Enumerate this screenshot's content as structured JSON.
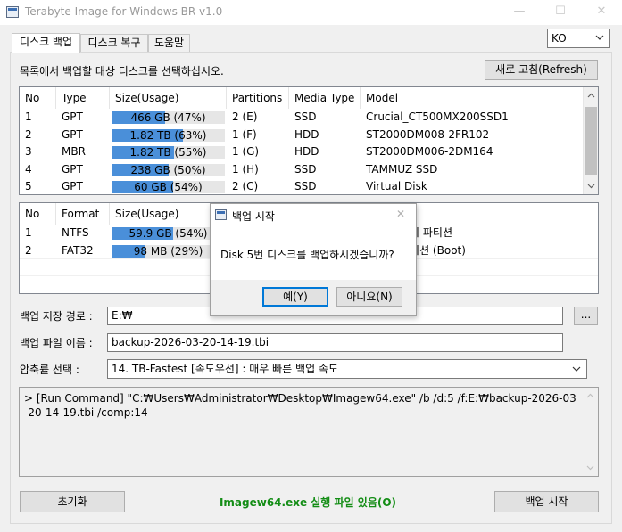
{
  "window": {
    "title": "Terabyte Image for Windows BR v1.0",
    "minimize": "—",
    "maximize": "☐",
    "close": "✕"
  },
  "tabs": [
    {
      "label": "디스크 백업",
      "active": true
    },
    {
      "label": "디스크 복구",
      "active": false
    },
    {
      "label": "도움말",
      "active": false
    }
  ],
  "language": {
    "selected": "KO"
  },
  "instruction": "목록에서 백업할 대상 디스크를 선택하십시오.",
  "refresh_label": "새로 고침(Refresh)",
  "disks": {
    "columns": [
      "No",
      "Type",
      "Size(Usage)",
      "Partitions",
      "Media Type",
      "Model"
    ],
    "rows": [
      {
        "no": "1",
        "type": "GPT",
        "size": "466 GB (47%)",
        "usage": 0.47,
        "partitions": "2 (E)",
        "media": "SSD",
        "model": "Crucial_CT500MX200SSD1"
      },
      {
        "no": "2",
        "type": "GPT",
        "size": "1.82 TB (63%)",
        "usage": 0.63,
        "partitions": "1 (F)",
        "media": "HDD",
        "model": "ST2000DM008-2FR102"
      },
      {
        "no": "3",
        "type": "MBR",
        "size": "1.82 TB (55%)",
        "usage": 0.55,
        "partitions": "1 (G)",
        "media": "HDD",
        "model": "ST2000DM006-2DM164"
      },
      {
        "no": "4",
        "type": "GPT",
        "size": "238 GB (50%)",
        "usage": 0.5,
        "partitions": "1 (H)",
        "media": "SSD",
        "model": "TAMMUZ SSD"
      },
      {
        "no": "5",
        "type": "GPT",
        "size": "60 GB (54%)",
        "usage": 0.54,
        "partitions": "2 (C)",
        "media": "SSD",
        "model": "Virtual Disk"
      }
    ]
  },
  "partitions": {
    "columns": [
      "No",
      "Format",
      "Size(Usage)"
    ],
    "rows": [
      {
        "no": "1",
        "format": "NTFS",
        "size": "59.9 GB (54%)",
        "usage": 0.54,
        "label": "설치 파티션"
      },
      {
        "no": "2",
        "format": "FAT32",
        "size": "98 MB (29%)",
        "usage": 0.29,
        "label": "파티션 (Boot)"
      }
    ]
  },
  "backup_path": {
    "label": "백업 저장 경로 :",
    "value": "E:₩",
    "browse": "..."
  },
  "backup_file": {
    "label": "백업 파일 이름 :",
    "value": "backup-2026-03-20-14-19.tbi"
  },
  "compression": {
    "label": "압축률 선택 :",
    "value": "14. TB-Fastest [속도우선] : 매우 빠른 백업 속도"
  },
  "log": "> [Run Command] \"C:₩Users₩Administrator₩Desktop₩Imagew64.exe\" /b /d:5 /f:E:₩backup-2026-03-20-14-19.tbi /comp:14",
  "reset_label": "초기화",
  "status": "Imagew64.exe 실행 파일 있음(O)",
  "start_label": "백업 시작",
  "dialog": {
    "title": "백업 시작",
    "message": "Disk 5번 디스크를 백업하시겠습니까?",
    "yes": "예(Y)",
    "no": "아니요(N)",
    "close": "✕"
  },
  "colors": {
    "usage_bar": "#4a8fd9",
    "status_text": "#138d15",
    "dialog_default_border": "#0078d7"
  }
}
